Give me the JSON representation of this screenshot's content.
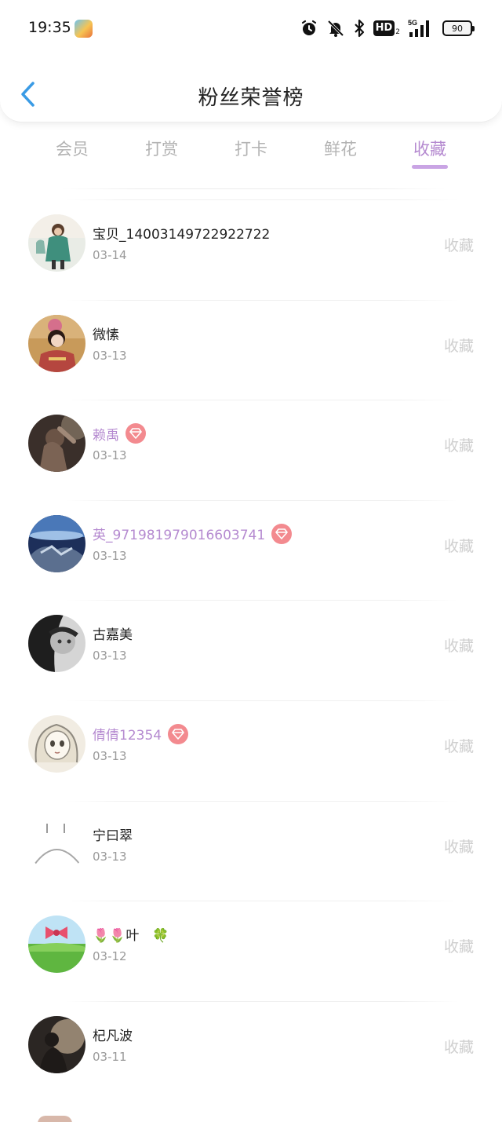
{
  "status_bar": {
    "time": "19:35",
    "icons": [
      "app-icon",
      "alarm-icon",
      "mute-bell-icon",
      "bluetooth-icon",
      "hd-icon",
      "5g-signal-icon",
      "battery-icon"
    ],
    "hd_label": "HD",
    "hd_sub": "2",
    "network": "5G",
    "battery": "90"
  },
  "nav": {
    "back_icon": "chevron-left-icon",
    "title": "粉丝荣誉榜",
    "accent_color": "#3a9be5"
  },
  "tabs": [
    {
      "label": "会员",
      "active": false
    },
    {
      "label": "打赏",
      "active": false
    },
    {
      "label": "打卡",
      "active": false
    },
    {
      "label": "鲜花",
      "active": false
    },
    {
      "label": "收藏",
      "active": true
    }
  ],
  "colors": {
    "active_tab": "#b58ad0",
    "vip_name": "#b58ad0",
    "vip_badge": "#f38a8f",
    "muted_text": "#9a9a9a",
    "action_text": "#cfcfcf"
  },
  "rows": [
    {
      "name": "宝贝_14003149722922722",
      "date": "03-14",
      "vip": false,
      "action": "收藏",
      "avatar": "girl-green-coat-avatar"
    },
    {
      "name": "微愫",
      "date": "03-13",
      "vip": false,
      "action": "收藏",
      "avatar": "kimono-girl-avatar"
    },
    {
      "name": "赖禹",
      "date": "03-13",
      "vip": true,
      "badge_icon": "diamond-icon",
      "action": "收藏",
      "avatar": "dark-portrait-avatar"
    },
    {
      "name": "英_97198197901660374​1",
      "date": "03-13",
      "vip": true,
      "badge_icon": "diamond-icon",
      "action": "收藏",
      "avatar": "sea-rock-avatar"
    },
    {
      "name": "古嘉美",
      "date": "03-13",
      "vip": false,
      "action": "收藏",
      "avatar": "bw-portrait-avatar"
    },
    {
      "name": "倩倩12354",
      "date": "03-13",
      "vip": true,
      "badge_icon": "diamond-icon",
      "action": "收藏",
      "avatar": "anime-sketch-avatar"
    },
    {
      "name": "宁曰翠",
      "date": "03-13",
      "vip": false,
      "action": "收藏",
      "avatar": "line-face-avatar"
    },
    {
      "name": "🌷🌷叶　🍀",
      "date": "03-12",
      "vip": false,
      "action": "收藏",
      "avatar": "bow-meadow-avatar"
    },
    {
      "name": "杞凡波",
      "date": "03-11",
      "vip": false,
      "action": "收藏",
      "avatar": "sunset-silhouette-avatar"
    }
  ]
}
